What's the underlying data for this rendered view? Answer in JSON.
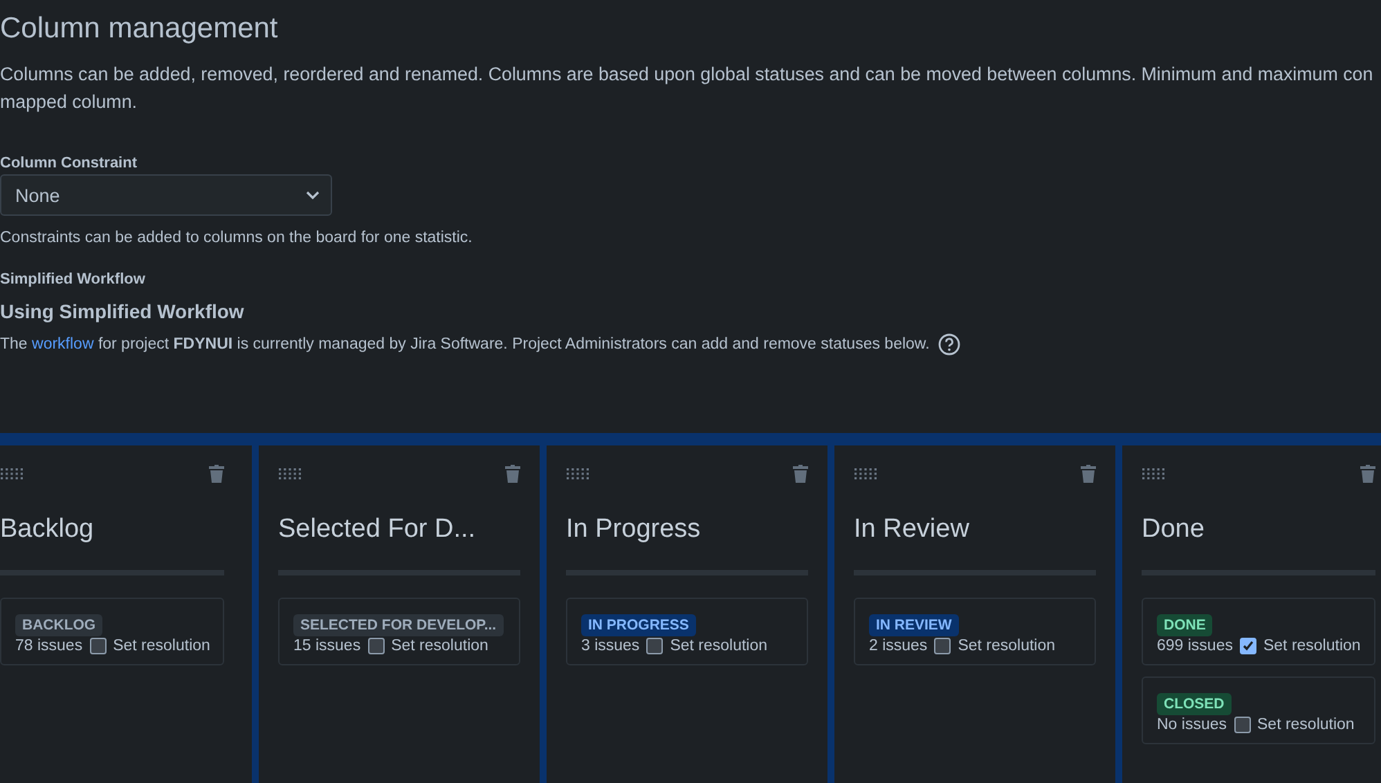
{
  "title": "Column management",
  "description_lines": [
    "Columns can be added, removed, reordered and renamed. Columns are based upon global statuses and can be moved between columns. Minimum and maximum con",
    "mapped column."
  ],
  "constraint": {
    "label": "Column Constraint",
    "value": "None",
    "help": "Constraints can be added to columns on the board for one statistic."
  },
  "workflow": {
    "label": "Simplified Workflow",
    "heading": "Using Simplified Workflow",
    "text_before": "The ",
    "link": "workflow",
    "text_after": " for project **FDYNUI** is currently managed by Jira Software. Project Administrators can add and remove statuses below."
  },
  "columns": [
    {
      "name": "Backlog",
      "statuses": [
        {
          "label": "BACKLOG",
          "color": "#2c333a",
          "issues": "78 issues",
          "resolution_label": "Set resolution",
          "checked": false
        }
      ]
    },
    {
      "name": "Selected For D...",
      "statuses": [
        {
          "label": "SELECTED FOR DEVELOP...",
          "color": "#2c333a",
          "issues": "15 issues",
          "resolution_label": "Set resolution",
          "checked": false
        }
      ]
    },
    {
      "name": "In Progress",
      "statuses": [
        {
          "label": "IN PROGRESS",
          "color": "#09326c",
          "issues": "3 issues",
          "resolution_label": "Set resolution",
          "checked": false
        }
      ]
    },
    {
      "name": "In Review",
      "statuses": [
        {
          "label": "IN REVIEW",
          "color": "#09326c",
          "issues": "2 issues",
          "resolution_label": "Set resolution",
          "checked": false
        }
      ]
    },
    {
      "name": "Done",
      "statuses": [
        {
          "label": "DONE",
          "color": "#164b35",
          "issues": "699 issues",
          "resolution_label": "Set resolution",
          "checked": true
        },
        {
          "label": "CLOSED",
          "color": "#164b35",
          "issues": "No issues",
          "resolution_label": "Set resolution",
          "checked": false
        }
      ]
    }
  ]
}
